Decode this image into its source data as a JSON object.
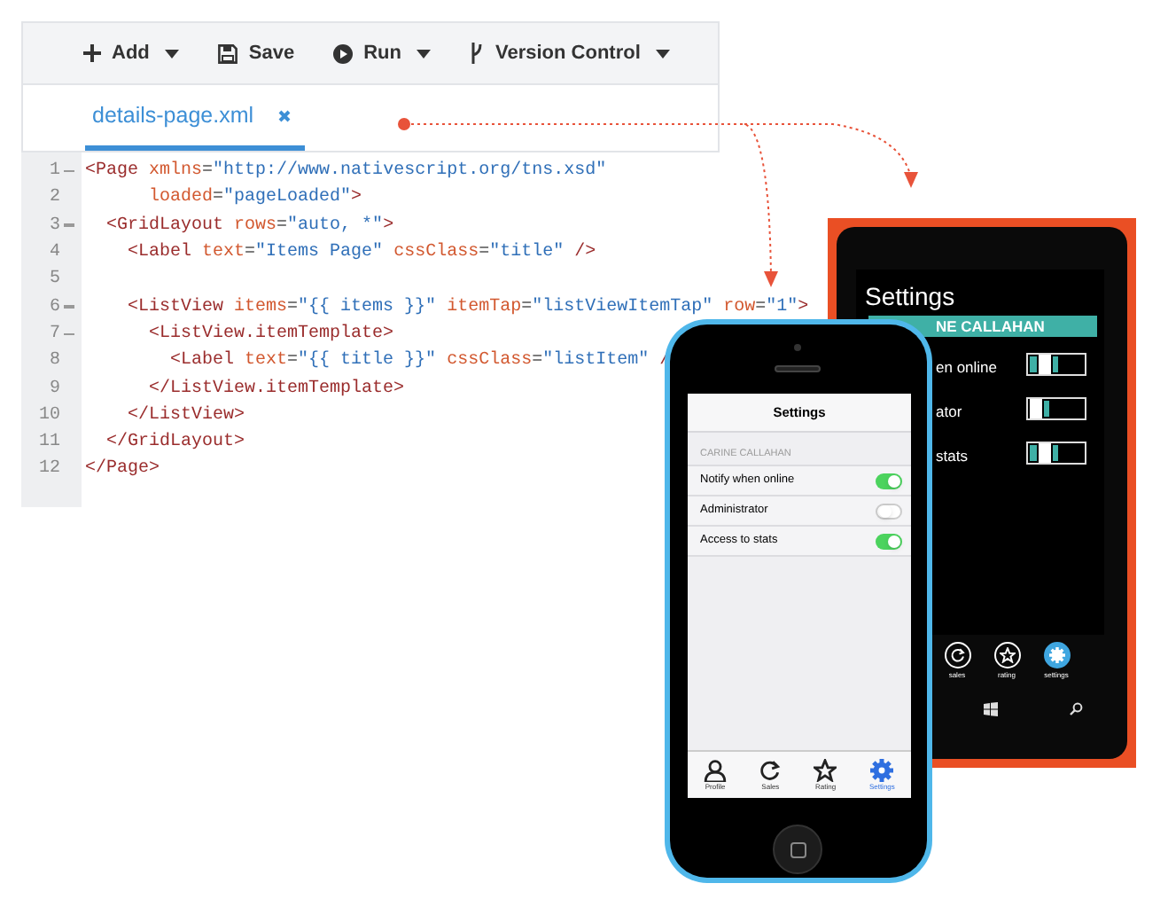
{
  "toolbar": [
    {
      "kind": "plus",
      "label": "Add",
      "caret": true
    },
    {
      "kind": "save",
      "label": "Save",
      "caret": false
    },
    {
      "kind": "play",
      "label": "Run",
      "caret": true
    },
    {
      "kind": "branch",
      "label": "Version Control",
      "caret": true
    }
  ],
  "tab": {
    "label": "details-page.xml",
    "selected": true
  },
  "code_lines": [
    {
      "number": "1",
      "foldable": true,
      "tokens": [
        {
          "kind": "tag",
          "text": "<Page"
        },
        {
          "kind": "attr",
          "text": " xmlns"
        },
        {
          "kind": "punct",
          "text": "="
        },
        {
          "kind": "value",
          "text": "\"http://www.nativescript.org/tns.xsd\""
        }
      ]
    },
    {
      "number": "2",
      "foldable": false,
      "tokens": [
        {
          "kind": "attr",
          "text": "      loaded"
        },
        {
          "kind": "punct",
          "text": "="
        },
        {
          "kind": "value",
          "text": "\"pageLoaded\""
        },
        {
          "kind": "tag",
          "text": ">"
        }
      ]
    },
    {
      "number": "3",
      "foldable": true,
      "tokens": [
        {
          "kind": "tag",
          "text": "  <GridLayout"
        },
        {
          "kind": "attr",
          "text": " rows"
        },
        {
          "kind": "punct",
          "text": "="
        },
        {
          "kind": "value",
          "text": "\"auto, *\""
        },
        {
          "kind": "tag",
          "text": ">"
        }
      ]
    },
    {
      "number": "4",
      "foldable": false,
      "tokens": [
        {
          "kind": "tag",
          "text": "    <Label"
        },
        {
          "kind": "attr",
          "text": " text"
        },
        {
          "kind": "punct",
          "text": "="
        },
        {
          "kind": "value",
          "text": "\"Items Page\""
        },
        {
          "kind": "attr",
          "text": " cssClass"
        },
        {
          "kind": "punct",
          "text": "="
        },
        {
          "kind": "value",
          "text": "\"title\""
        },
        {
          "kind": "tag",
          "text": " />"
        }
      ]
    },
    {
      "number": "5",
      "foldable": false
    },
    {
      "number": "6",
      "foldable": true,
      "tokens": [
        {
          "kind": "tag",
          "text": "    <ListView"
        },
        {
          "kind": "attr",
          "text": " items"
        },
        {
          "kind": "punct",
          "text": "="
        },
        {
          "kind": "value",
          "text": "\"{{ items }}\""
        },
        {
          "kind": "attr",
          "text": " itemTap"
        },
        {
          "kind": "punct",
          "text": "="
        },
        {
          "kind": "value",
          "text": "\"listViewItemTap\""
        },
        {
          "kind": "attr",
          "text": " row"
        },
        {
          "kind": "punct",
          "text": "="
        },
        {
          "kind": "value",
          "text": "\"1\""
        },
        {
          "kind": "tag",
          "text": ">"
        }
      ]
    },
    {
      "number": "7",
      "foldable": true,
      "tokens": [
        {
          "kind": "tag",
          "text": "      <ListView.itemTemplate>"
        }
      ]
    },
    {
      "number": "8",
      "foldable": false,
      "tokens": [
        {
          "kind": "tag",
          "text": "        <Label"
        },
        {
          "kind": "attr",
          "text": " text"
        },
        {
          "kind": "punct",
          "text": "="
        },
        {
          "kind": "value",
          "text": "\"{{ title }}\""
        },
        {
          "kind": "attr",
          "text": " cssClass"
        },
        {
          "kind": "punct",
          "text": "="
        },
        {
          "kind": "value",
          "text": "\"listItem\""
        },
        {
          "kind": "tag",
          "text": " /"
        }
      ]
    },
    {
      "number": "9",
      "foldable": false,
      "tokens": [
        {
          "kind": "tag",
          "text": "      </ListView.itemTemplate>"
        }
      ]
    },
    {
      "number": "10",
      "foldable": false,
      "tokens": [
        {
          "kind": "tag",
          "text": "    </ListView>"
        }
      ]
    },
    {
      "number": "11",
      "foldable": false,
      "tokens": [
        {
          "kind": "tag",
          "text": "  </GridLayout>"
        }
      ]
    },
    {
      "number": "12",
      "foldable": false,
      "tokens": [
        {
          "kind": "tag",
          "text": "</Page>"
        }
      ]
    }
  ],
  "windows_phone": {
    "title": "Settings",
    "section": "NE CALLAHAN",
    "rows": [
      {
        "label": "en online",
        "on": true
      },
      {
        "label": "ator",
        "on": false
      },
      {
        "label": "stats",
        "on": true
      }
    ],
    "app_bar": [
      {
        "kind": "refresh",
        "label": "sales",
        "selected": false
      },
      {
        "kind": "star",
        "label": "rating",
        "selected": false
      },
      {
        "kind": "gear",
        "label": "settings",
        "selected": true
      }
    ]
  },
  "iphone": {
    "title": "Settings",
    "section": "CARINE CALLAHAN",
    "rows": [
      {
        "label": "Notify when online",
        "on": true
      },
      {
        "label": "Administrator",
        "on": false
      },
      {
        "label": "Access to stats",
        "on": true
      }
    ],
    "tabs": [
      {
        "kind": "person",
        "label": "Profile",
        "selected": false
      },
      {
        "kind": "refresh",
        "label": "Sales",
        "selected": false
      },
      {
        "kind": "star",
        "label": "Rating",
        "selected": false
      },
      {
        "kind": "gear",
        "label": "Settings",
        "selected": true
      }
    ]
  }
}
